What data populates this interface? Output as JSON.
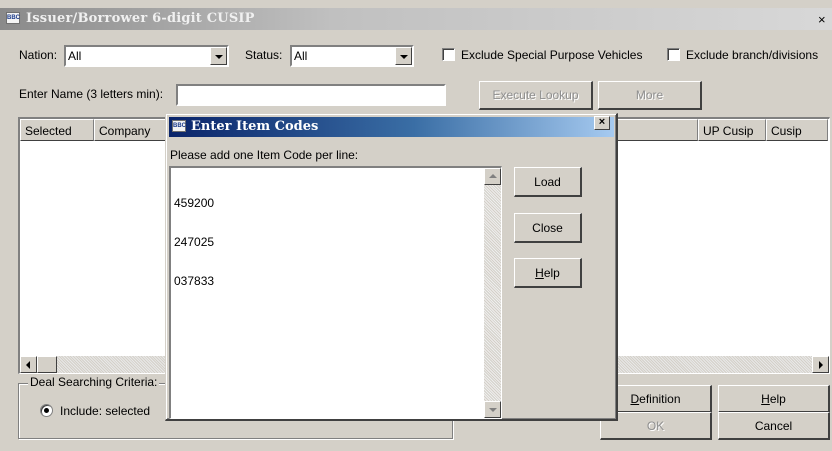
{
  "main_window": {
    "title": "Issuer/Borrower 6-digit CUSIP",
    "close_glyph": "×",
    "app_icon_text": "BBC"
  },
  "filters": {
    "nation_label": "Nation:",
    "nation_value": "All",
    "status_label": "Status:",
    "status_value": "All",
    "exclude_spv_label": "Exclude Special Purpose Vehicles",
    "exclude_branch_label": "Exclude branch/divisions"
  },
  "search": {
    "name_label": "Enter Name (3 letters min):",
    "name_value": "",
    "execute_label": "Execute Lookup",
    "more_label": "More"
  },
  "results": {
    "columns": [
      "Selected",
      "Company",
      "UP Cusip",
      "Cusip"
    ]
  },
  "deal_criteria": {
    "title": "Deal Searching Criteria:",
    "include_label": "Include: selected"
  },
  "bottom_buttons": {
    "definition": {
      "mnemonic": "D",
      "rest": "efinition"
    },
    "help": {
      "mnemonic": "H",
      "rest": "elp"
    },
    "ok": "OK",
    "cancel": "Cancel"
  },
  "dialog": {
    "title": "Enter Item Codes",
    "close_glyph": "×",
    "instruction": "Please add one Item Code per line:",
    "codes": [
      "459200",
      "247025",
      "037833"
    ],
    "load_label": "Load",
    "close_label": "Close",
    "help": {
      "mnemonic": "H",
      "rest": "elp"
    }
  }
}
